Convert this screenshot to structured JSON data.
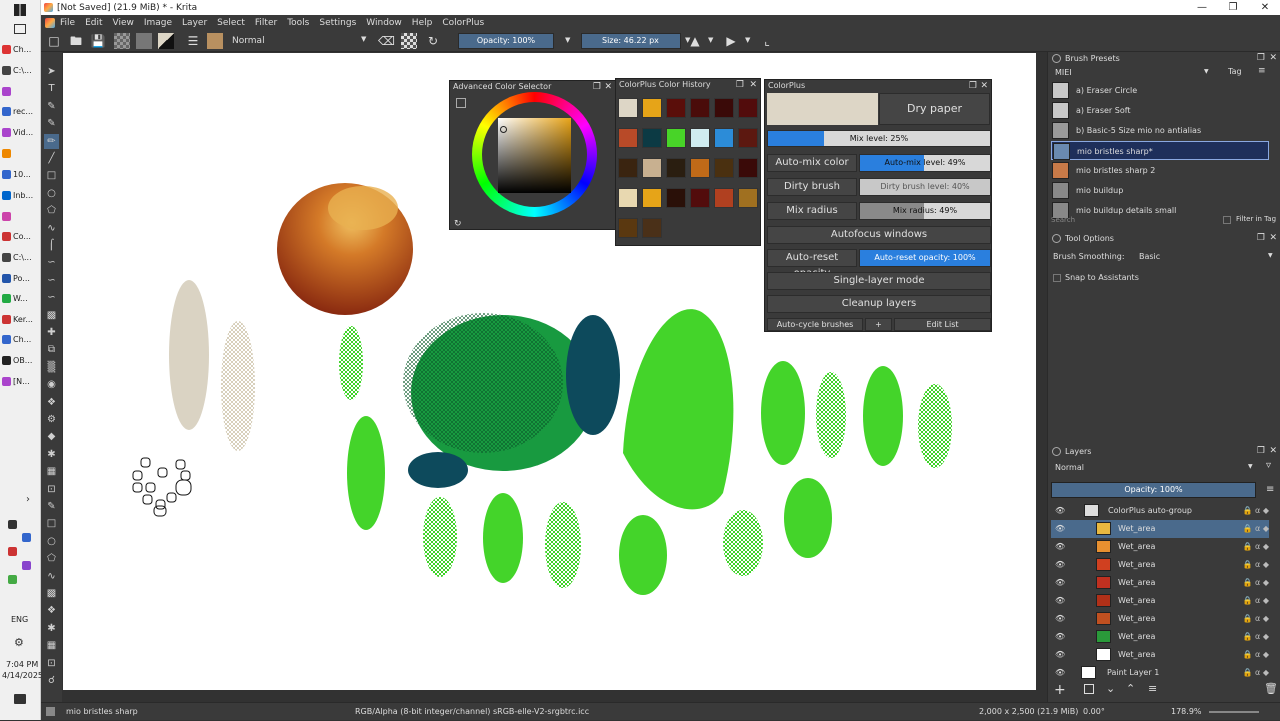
{
  "window": {
    "title": "[Not Saved]  (21.9 MiB) * - Krita"
  },
  "menu": [
    "File",
    "Edit",
    "View",
    "Image",
    "Layer",
    "Select",
    "Filter",
    "Tools",
    "Settings",
    "Window",
    "Help",
    "ColorPlus"
  ],
  "toolbar": {
    "blend_mode": "Normal",
    "opacity": "Opacity: 100%",
    "size": "Size: 46.22 px"
  },
  "taskbar": {
    "items": [
      "Ch...",
      "C:\\...",
      "",
      "rec...",
      "Vid...",
      "",
      "10...",
      "Inb...",
      "",
      "Co...",
      "C:\\...",
      "Po...",
      "W...",
      "Ker...",
      "Ch...",
      "OB...",
      "[N..."
    ],
    "lang": "ENG",
    "time": "7:04 PM",
    "date": "4/14/2025"
  },
  "advanced_color_selector": {
    "title": "Advanced Color Selector"
  },
  "color_history": {
    "title": "ColorPlus Color History",
    "swatches": [
      "#ddd6c6",
      "#e6a418",
      "#5a0e0a",
      "#4a0c0a",
      "#3a0a08",
      "#520c0c",
      "#b84a28",
      "#0c3a44",
      "#48d428",
      "#d0ecf0",
      "#2c8cd8",
      "#5c1810",
      "#3a2410",
      "#c8b090",
      "#2a1e10",
      "#c06a18",
      "#4a3010",
      "#3a0a08",
      "#e8d8b0",
      "#e6a418",
      "#2a1008",
      "#520c0c",
      "#b04020",
      "#a07020",
      "#5a3810",
      "#4a3018"
    ]
  },
  "colorplus": {
    "title": "ColorPlus",
    "dry_paper": "Dry paper",
    "mix_level": "Mix level: 25%",
    "mix_level_value": 0.25,
    "auto_mix_color": "Auto-mix color",
    "auto_mix_level": "Auto-mix level: 49%",
    "auto_mix_value": 0.49,
    "dirty_brush": "Dirty brush",
    "dirty_brush_level": "Dirty brush level: 40%",
    "dirty_value": 0.0,
    "mix_radius": "Mix radius",
    "mix_radius_level": "Mix radius: 49%",
    "mix_radius_value": 0.49,
    "autofocus": "Autofocus windows",
    "auto_reset_opacity": "Auto-reset opacity",
    "auto_reset_opacity_level": "Auto-reset opacity: 100%",
    "auto_reset_value": 1.0,
    "single_layer": "Single-layer mode",
    "cleanup": "Cleanup layers",
    "auto_cycle": "Auto-cycle brushes",
    "plus": "+",
    "edit_list": "Edit List",
    "current_color": "#ddd6c6",
    "accent": "#2a7fde"
  },
  "brush_presets": {
    "title": "Brush Presets",
    "tag": "MIEI",
    "tag_label": "Tag",
    "items": [
      "a) Eraser Circle",
      "a) Eraser Soft",
      "b) Basic-5 Size mio no antialias",
      "mio bristles sharp*",
      "mio bristles sharp 2",
      "mio buildup",
      "mio buildup details small"
    ],
    "selected": 3,
    "search": "Search",
    "filter_in_tag": "Filter in Tag"
  },
  "tool_options": {
    "title": "Tool Options",
    "smoothing_label": "Brush Smoothing:",
    "smoothing_value": "Basic",
    "snap": "Snap to Assistants"
  },
  "layers": {
    "title": "Layers",
    "blend": "Normal",
    "opacity": "Opacity:  100%",
    "items": [
      "ColorPlus auto-group",
      "Wet_area",
      "Wet_area",
      "Wet_area",
      "Wet_area",
      "Wet_area",
      "Wet_area",
      "Wet_area",
      "Wet_area",
      "Paint Layer 1"
    ],
    "selected": 1
  },
  "status": {
    "brush": "mio bristles sharp",
    "color_space": "RGB/Alpha (8-bit integer/channel)  sRGB-elle-V2-srgbtrc.icc",
    "dims": "2,000 x 2,500 (21.9 MiB)",
    "rotation": "0.00°",
    "zoom": "178.9%"
  }
}
